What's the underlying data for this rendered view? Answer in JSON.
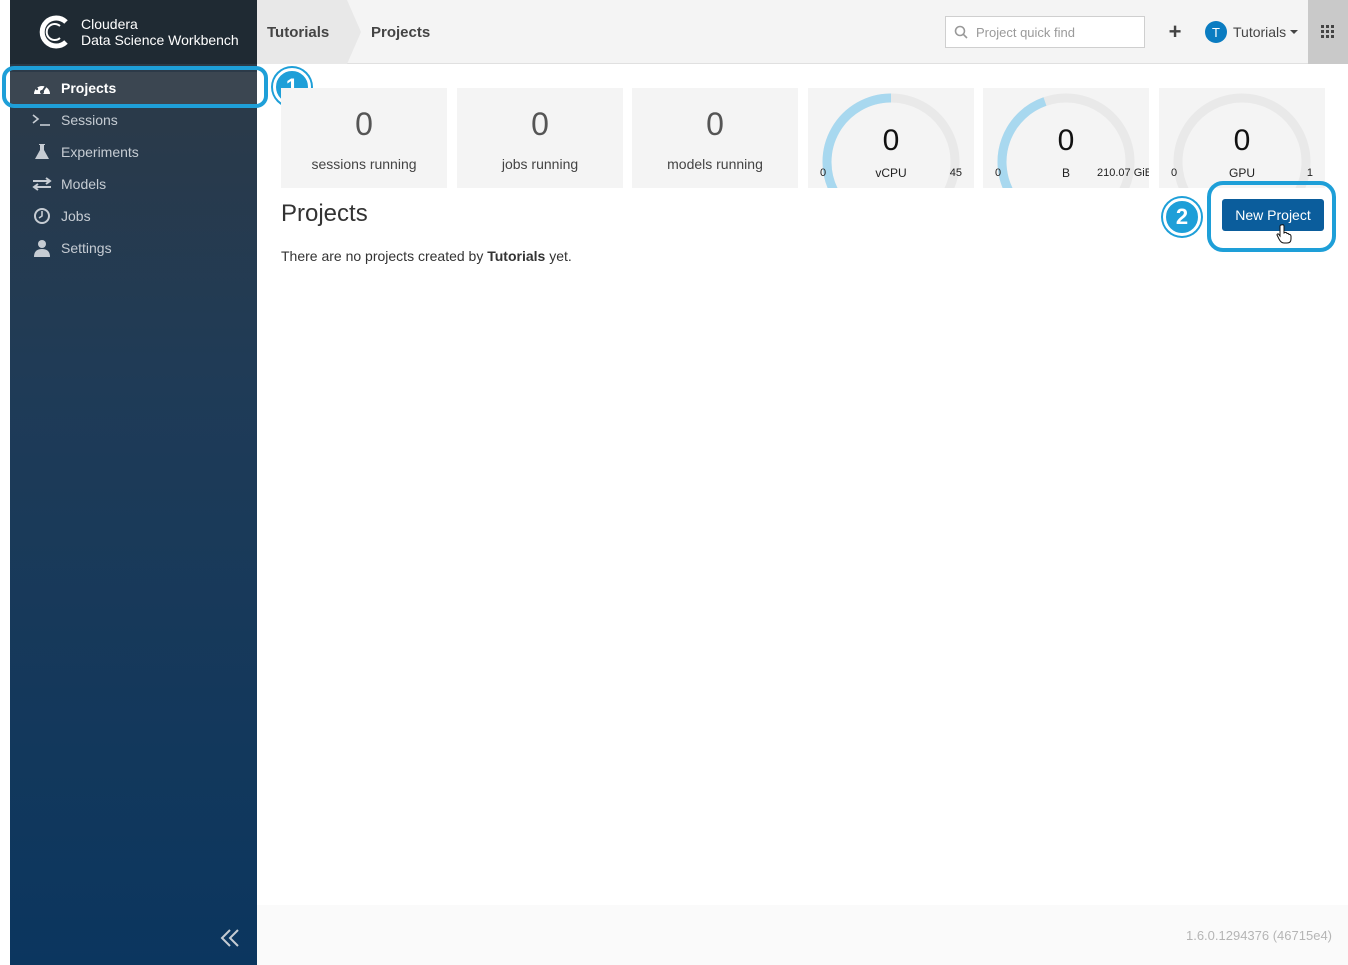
{
  "brand": {
    "line1": "Cloudera",
    "line2": "Data Science Workbench",
    "logo_icon": "cloudera-logo-icon"
  },
  "sidebar": {
    "items": [
      {
        "label": "Projects",
        "icon": "dashboard-icon",
        "active": true
      },
      {
        "label": "Sessions",
        "icon": "terminal-icon",
        "active": false
      },
      {
        "label": "Experiments",
        "icon": "flask-icon",
        "active": false
      },
      {
        "label": "Models",
        "icon": "exchange-arrows-icon",
        "active": false
      },
      {
        "label": "Jobs",
        "icon": "clock-icon",
        "active": false
      },
      {
        "label": "Settings",
        "icon": "user-icon",
        "active": false
      }
    ],
    "collapse_icon": "double-chevron-left-icon"
  },
  "header": {
    "breadcrumb": [
      "Tutorials",
      "Projects"
    ],
    "search_placeholder": "Project quick find",
    "user_initial": "T",
    "user_name": "Tutorials"
  },
  "stats": [
    {
      "value": "0",
      "label": "sessions running"
    },
    {
      "value": "0",
      "label": "jobs running"
    },
    {
      "value": "0",
      "label": "models running"
    }
  ],
  "gauges": [
    {
      "value": "0",
      "unit": "vCPU",
      "min": "0",
      "max": "45",
      "fill_fraction": 0.5
    },
    {
      "value": "0",
      "unit": "B",
      "min": "0",
      "max": "210.07 GiB",
      "fill_fraction": 0.42
    },
    {
      "value": "0",
      "unit": "GPU",
      "min": "0",
      "max": "1",
      "fill_fraction": 0.0
    }
  ],
  "main": {
    "title": "Projects",
    "empty_prefix": "There are no projects created by ",
    "empty_user": "Tutorials",
    "empty_suffix": " yet.",
    "new_project_label": "New Project"
  },
  "callouts": [
    "1",
    "2"
  ],
  "footer": {
    "version": "1.6.0.1294376 (46715e4)"
  },
  "colors": {
    "accent": "#1e9fd8",
    "primary_button": "#0b5d9c",
    "gauge_fill": "#a8d8ef",
    "gauge_track": "#e9e9e9"
  }
}
